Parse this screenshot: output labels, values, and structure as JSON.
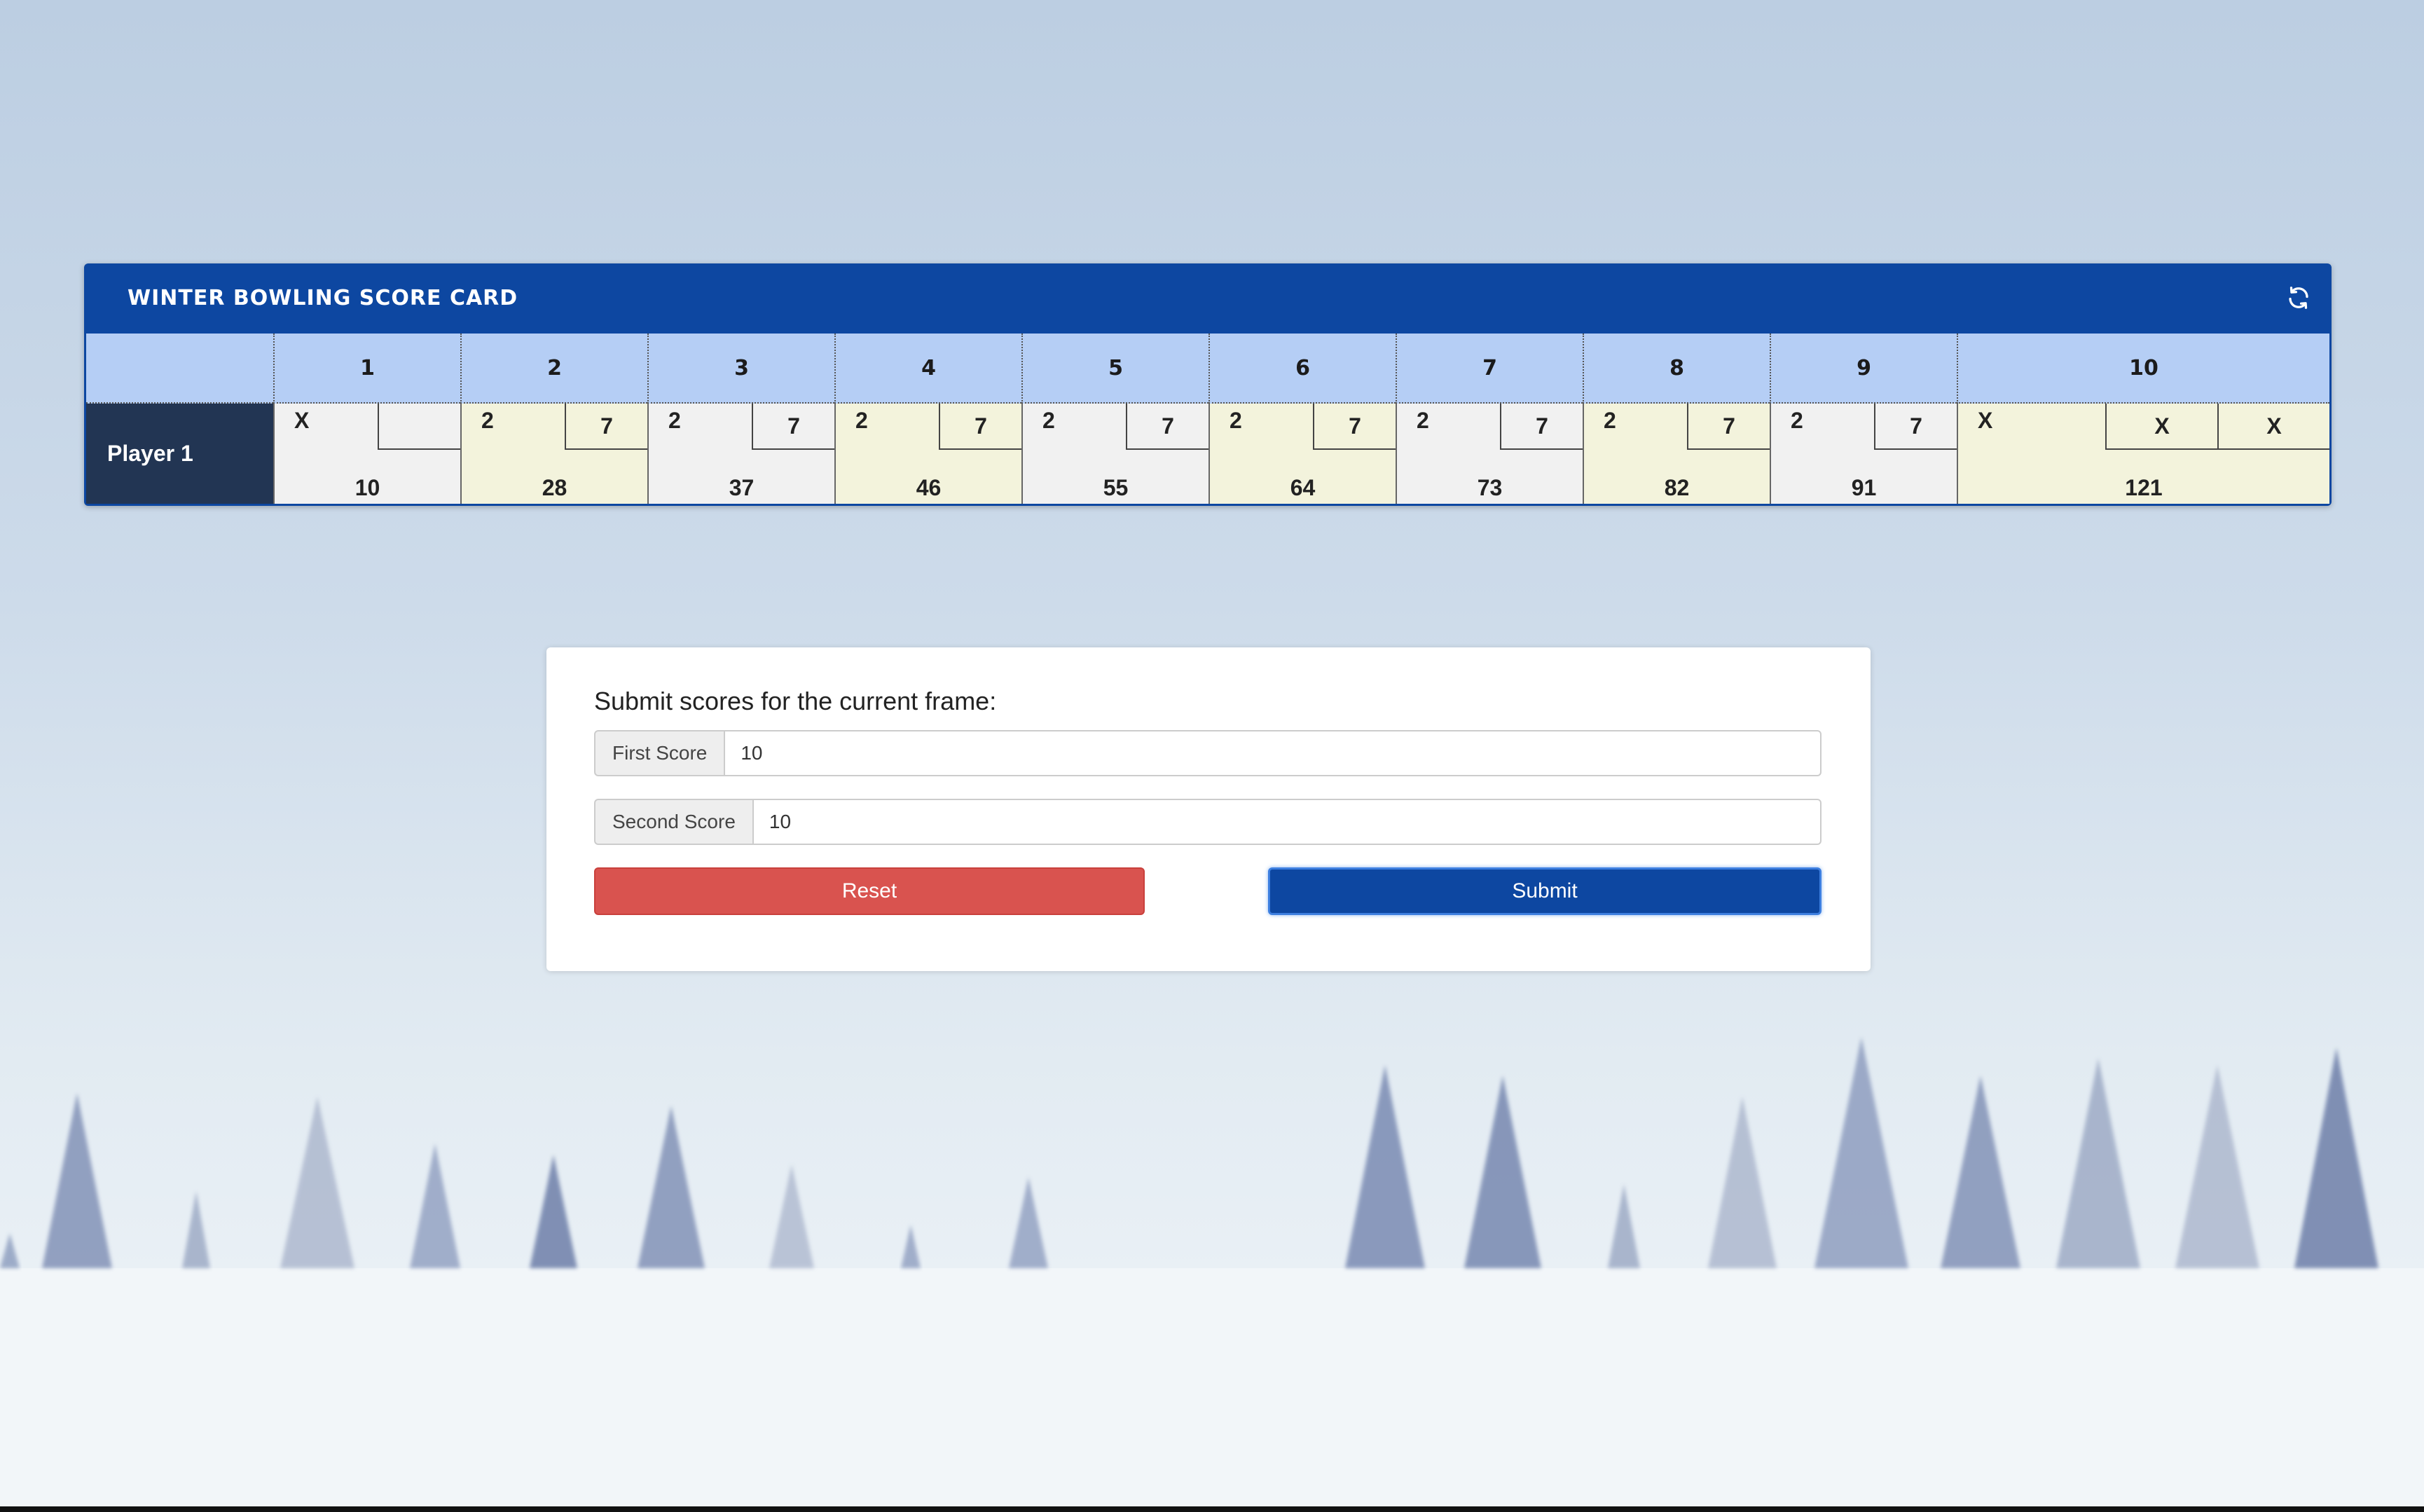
{
  "scorecard": {
    "title": "Winter Bowling Score Card",
    "refresh_icon": "refresh-icon",
    "frame_headers": [
      "",
      "1",
      "2",
      "3",
      "4",
      "5",
      "6",
      "7",
      "8",
      "9",
      "10"
    ],
    "player_name": "Player 1",
    "frames": [
      {
        "roll1": "X",
        "roll2": "",
        "total": "10"
      },
      {
        "roll1": "2",
        "roll2": "7",
        "total": "28"
      },
      {
        "roll1": "2",
        "roll2": "7",
        "total": "37"
      },
      {
        "roll1": "2",
        "roll2": "7",
        "total": "46"
      },
      {
        "roll1": "2",
        "roll2": "7",
        "total": "55"
      },
      {
        "roll1": "2",
        "roll2": "7",
        "total": "64"
      },
      {
        "roll1": "2",
        "roll2": "7",
        "total": "73"
      },
      {
        "roll1": "2",
        "roll2": "7",
        "total": "82"
      },
      {
        "roll1": "2",
        "roll2": "7",
        "total": "91"
      }
    ],
    "tenth": {
      "roll1": "X",
      "roll2": "X",
      "roll3": "X",
      "total": "121"
    }
  },
  "form": {
    "title": "Submit scores for the current frame:",
    "first_label": "First Score",
    "first_value": "10",
    "second_label": "Second Score",
    "second_value": "10",
    "reset_label": "Reset",
    "submit_label": "Submit"
  },
  "colors": {
    "header_blue": "#0d47a1",
    "frame_header": "#b5cef5",
    "player_cell": "#223553",
    "reset_red": "#d9534f"
  }
}
